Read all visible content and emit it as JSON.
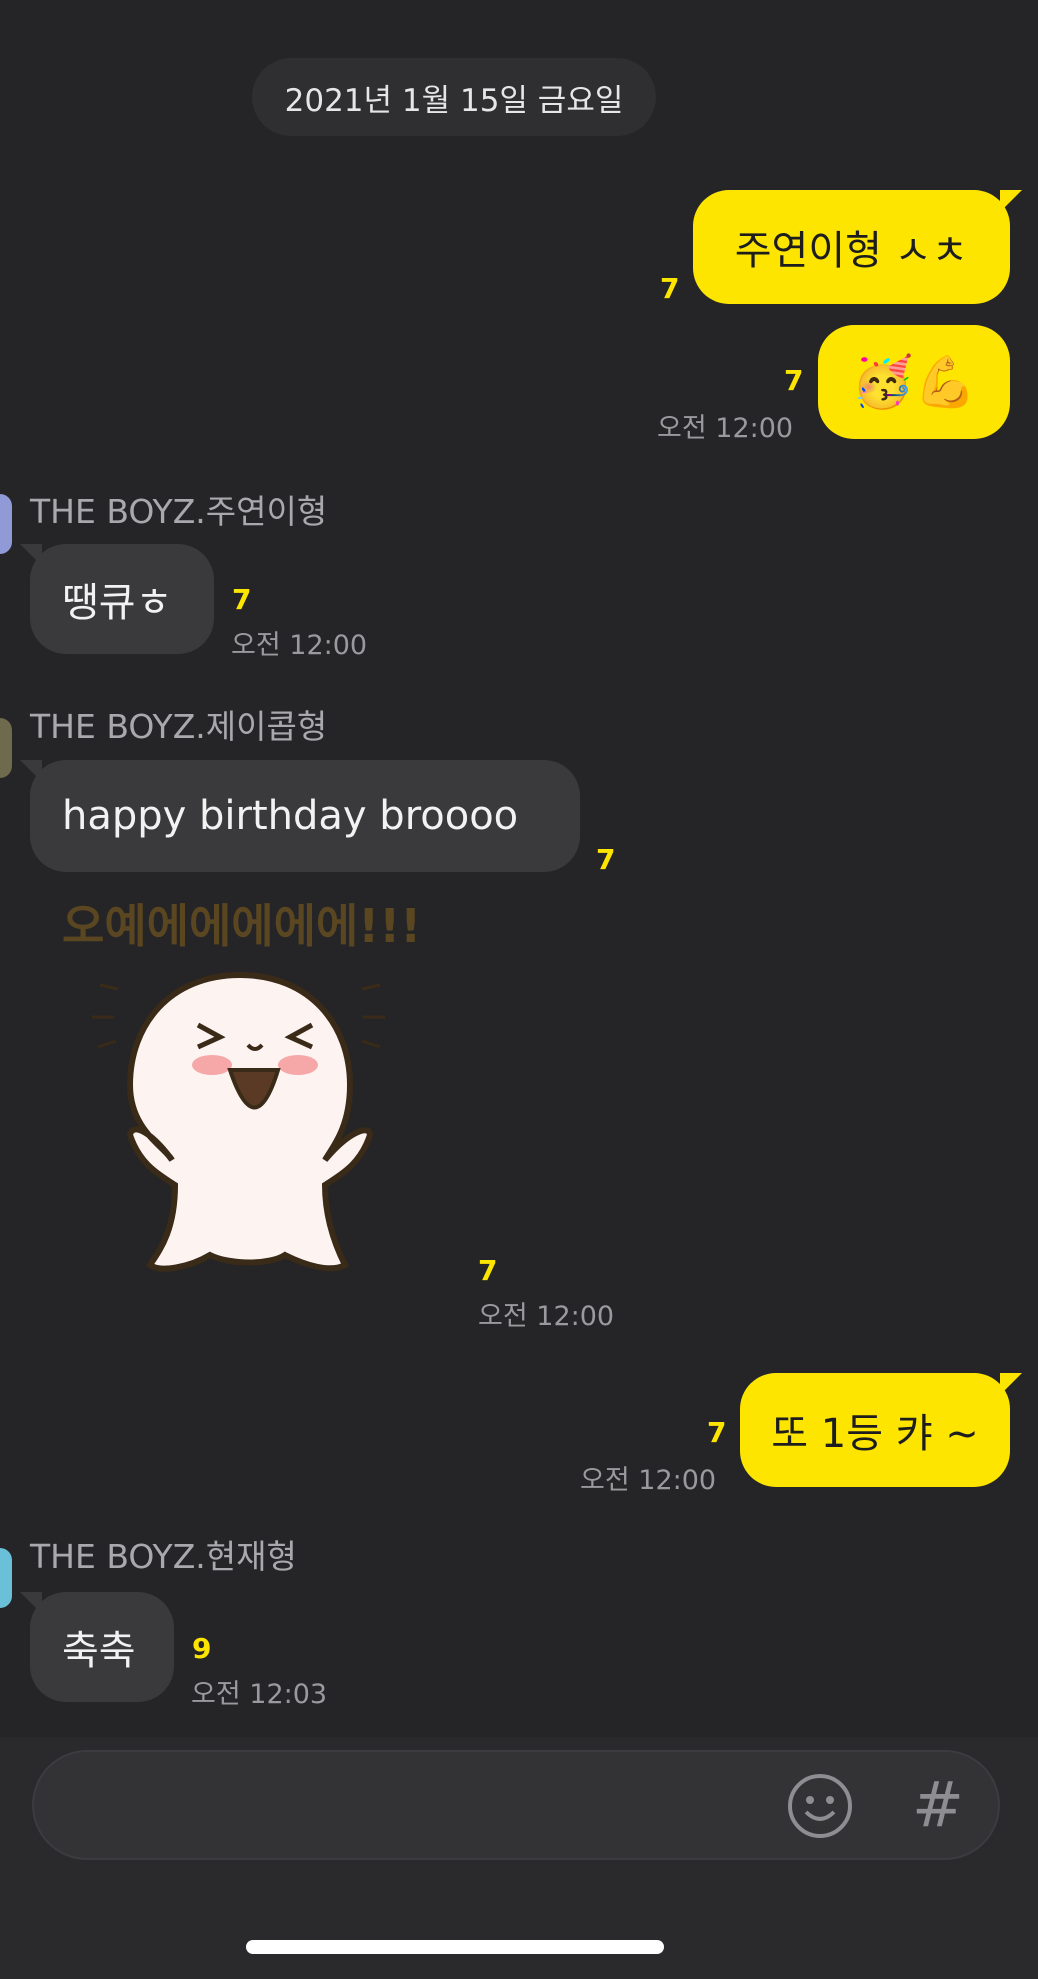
{
  "date_divider": "2021년 1월 15일 금요일",
  "messages": {
    "m1": {
      "text": "주연이형 ㅅㅊ",
      "unread": "7"
    },
    "m2": {
      "emoji": "🥳💪",
      "unread": "7",
      "time": "오전 12:00"
    },
    "m3": {
      "sender": "THE BOYZ.주연이형",
      "text": "땡큐ㅎ",
      "unread": "7",
      "time": "오전 12:00"
    },
    "m4": {
      "sender": "THE BOYZ.제이콥형",
      "text": "happy birthday broooo",
      "unread": "7"
    },
    "m5": {
      "sticker_caption": "오예에에에에에!!!",
      "unread": "7",
      "time": "오전 12:00"
    },
    "m6": {
      "text": "또 1등 캬 ~",
      "unread": "7",
      "time": "오전 12:00"
    },
    "m7": {
      "sender": "THE BOYZ.현재형",
      "text": "축축",
      "unread": "9",
      "time": "오전 12:03"
    }
  },
  "input": {
    "placeholder": "",
    "emoji_icon": "smiley-icon",
    "hash_icon": "#"
  },
  "colors": {
    "background": "#252527",
    "outgoing_bubble": "#fee500",
    "incoming_bubble": "#3a3a3c",
    "unread": "#fee500"
  }
}
